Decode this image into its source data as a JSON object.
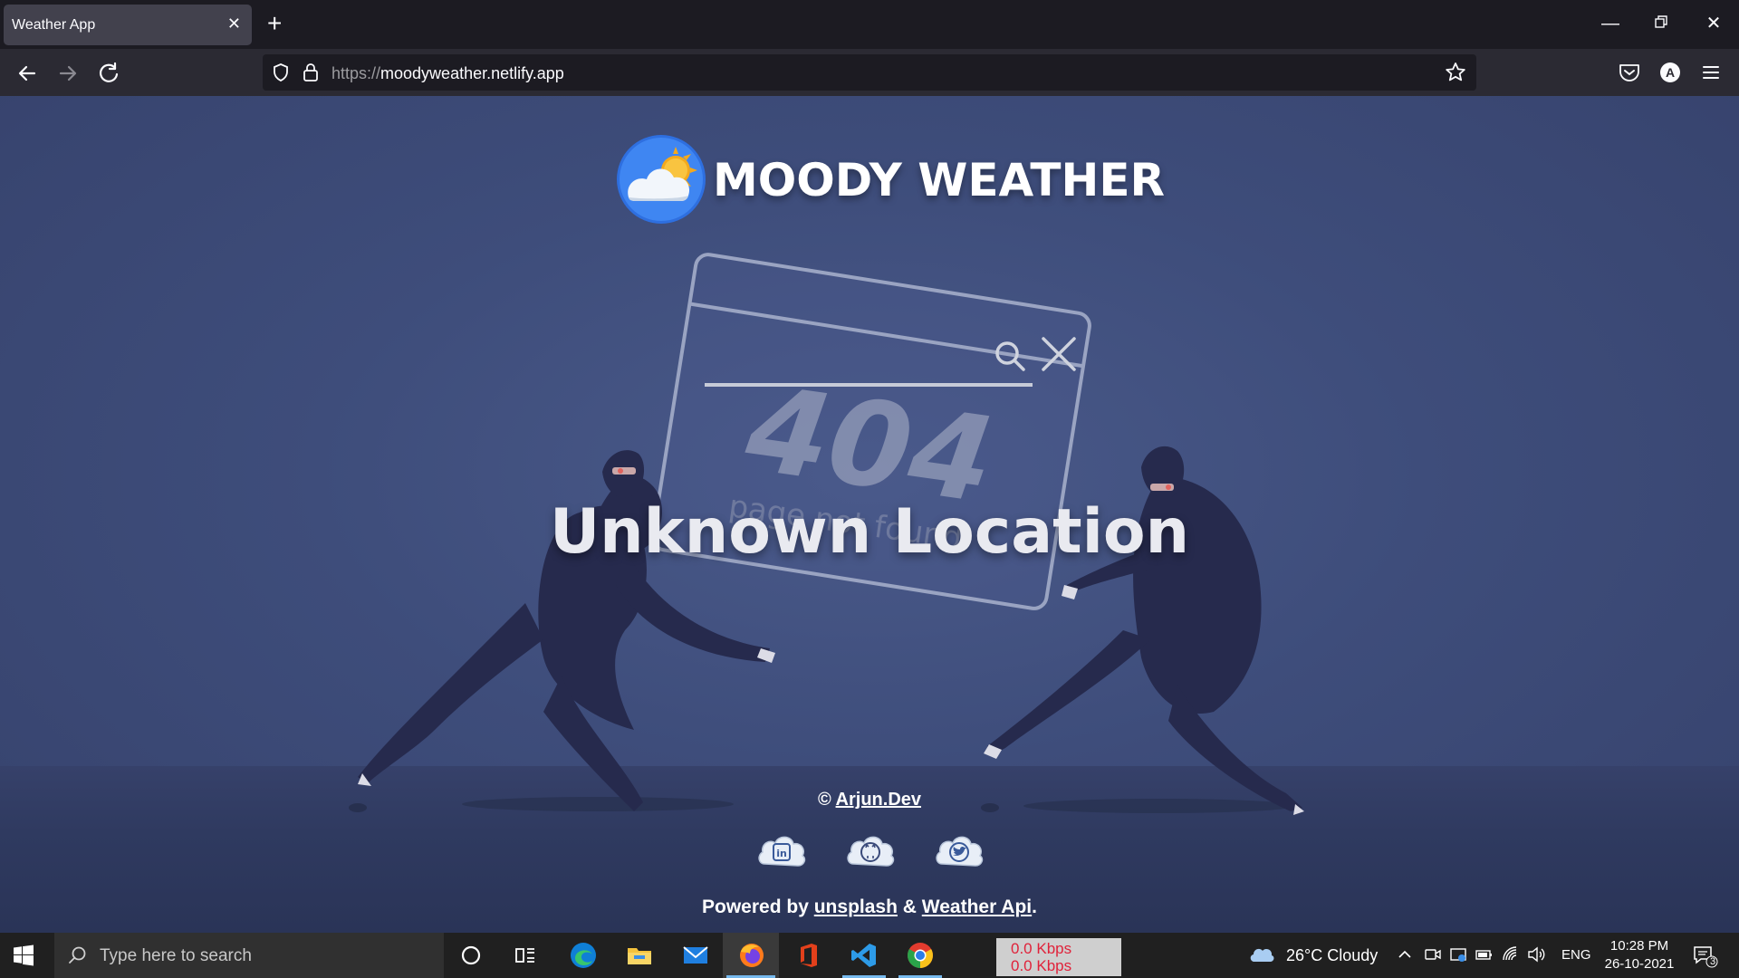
{
  "browser": {
    "tab_title": "Weather App",
    "url_protocol": "https://",
    "url_host": "moodyweather.netlify.app"
  },
  "page": {
    "brand_title": "MOODY WEATHER",
    "error_heading": "Unknown Location",
    "illustration_code": "404",
    "illustration_caption": "page not found",
    "credit_prefix": "©",
    "credit_link": "Arjun.Dev",
    "powered_prefix": "Powered by",
    "powered_link_1": "unsplash",
    "powered_amp": "&",
    "powered_link_2": "Weather Api",
    "powered_suffix": ".",
    "socials": [
      "linkedin-icon",
      "github-icon",
      "twitter-icon"
    ],
    "colors": {
      "background": "#3e4d7b",
      "text": "#ffffff"
    }
  },
  "taskbar": {
    "search_placeholder": "Type here to search",
    "net_up": "0.0 Kbps",
    "net_down": "0.0 Kbps",
    "weather": "26°C  Cloudy",
    "lang": "ENG",
    "time": "10:28 PM",
    "date": "26-10-2021",
    "notification_count": "3"
  }
}
